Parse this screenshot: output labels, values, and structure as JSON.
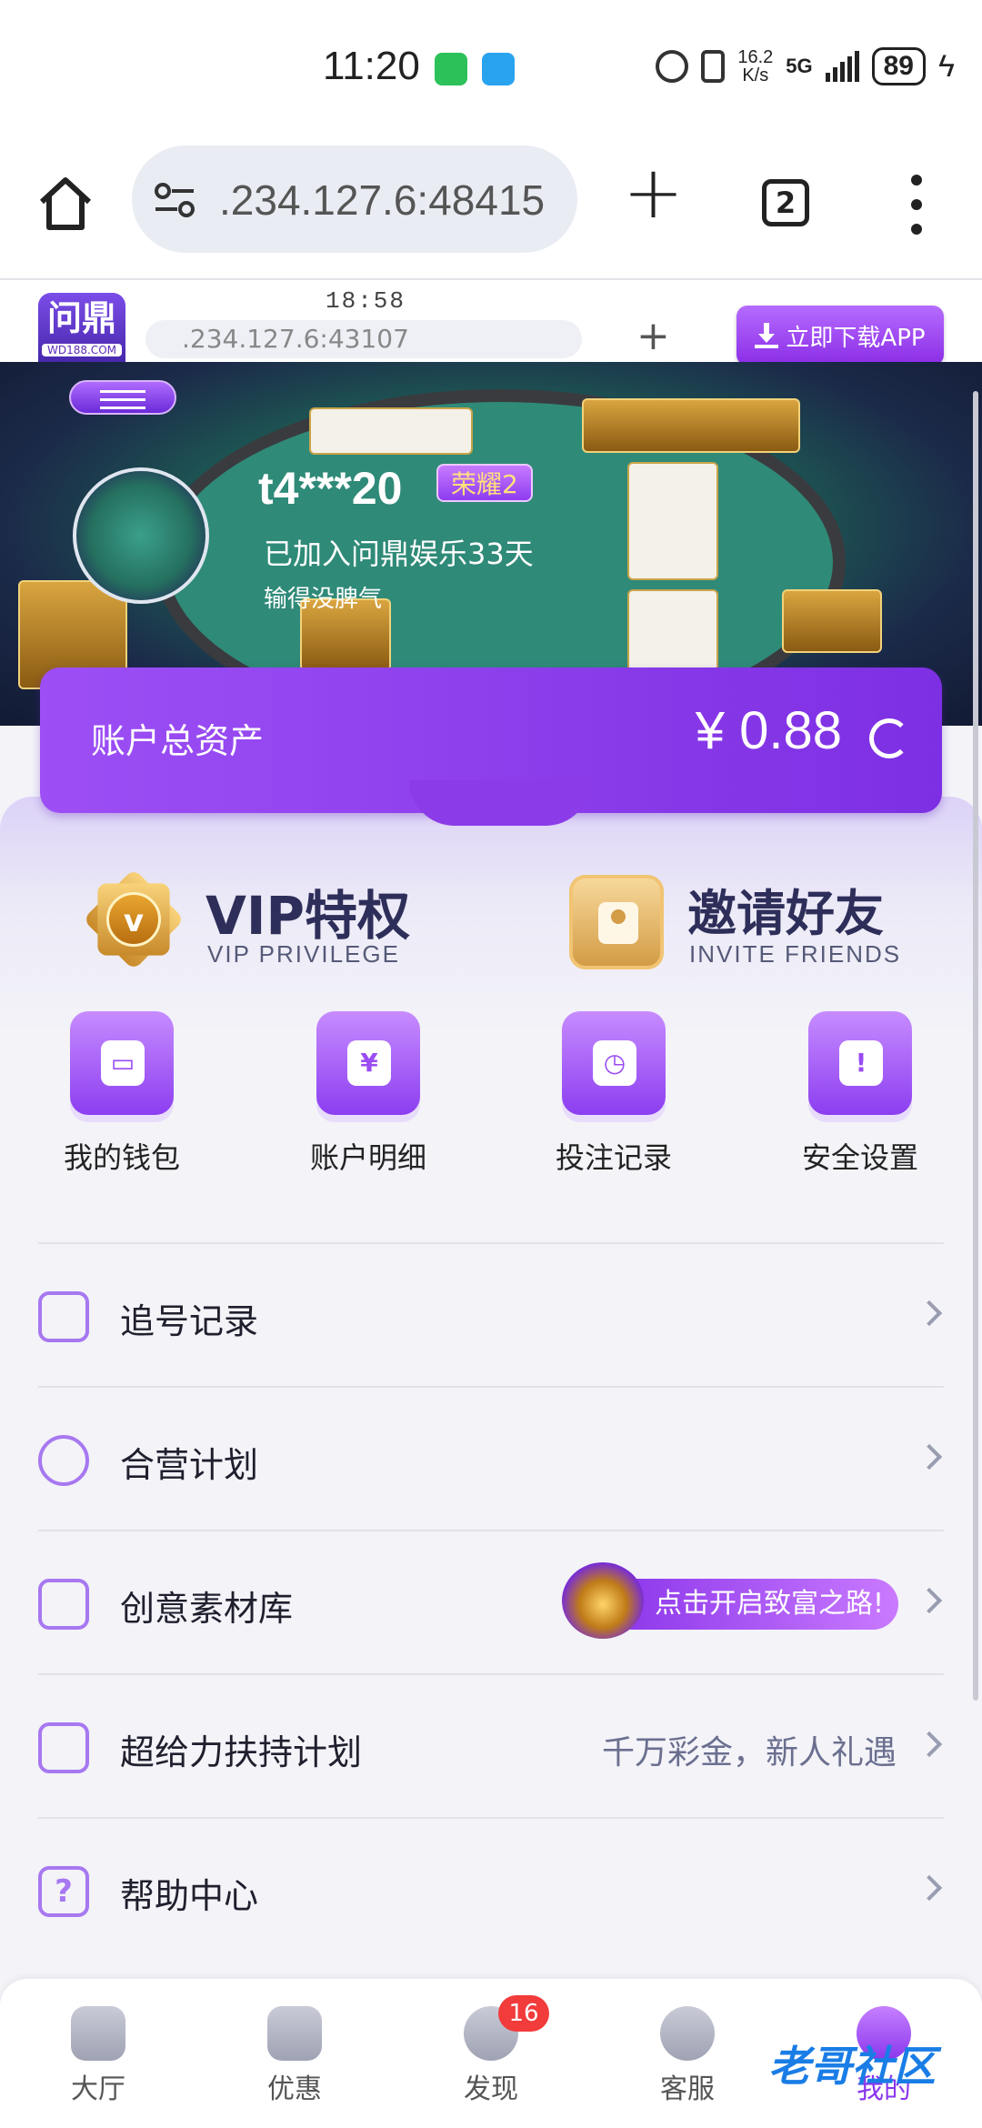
{
  "status_bar": {
    "time": "11:20",
    "net_speed": "16.2",
    "net_unit": "K/s",
    "network": "5G",
    "battery": "89"
  },
  "browser": {
    "url": ".234.127.6:48415",
    "tab_count": "2"
  },
  "inner_page": {
    "time": "18:58",
    "url": ".234.127.6:43107",
    "download_label": "立即下载APP",
    "logo_text": "问鼎",
    "logo_sub": "WD188.COM"
  },
  "profile": {
    "username": "t4***20",
    "rank": "荣耀2",
    "joined": "已加入问鼎娱乐33天",
    "motto": "输得没脾气"
  },
  "assets": {
    "label": "账户总资产",
    "amount": "¥ 0.88"
  },
  "features": {
    "vip": {
      "title": "VIP特权",
      "subtitle": "VIP PRIVILEGE",
      "badge": "v"
    },
    "invite": {
      "title": "邀请好友",
      "subtitle": "INVITE FRIENDS"
    }
  },
  "quick": [
    {
      "label": "我的钱包",
      "glyph": "▭"
    },
    {
      "label": "账户明细",
      "glyph": "¥"
    },
    {
      "label": "投注记录",
      "glyph": "◷"
    },
    {
      "label": "安全设置",
      "glyph": "!"
    }
  ],
  "rows": [
    {
      "label": "追号记录",
      "value": ""
    },
    {
      "label": "合营计划",
      "value": ""
    },
    {
      "label": "创意素材库",
      "value": "",
      "promo": "点击开启致富之路!"
    },
    {
      "label": "超给力扶持计划",
      "value": "千万彩金，新人礼遇"
    },
    {
      "label": "帮助中心",
      "value": ""
    }
  ],
  "nav": [
    {
      "label": "大厅"
    },
    {
      "label": "优惠"
    },
    {
      "label": "发现",
      "badge": "16"
    },
    {
      "label": "客服"
    },
    {
      "label": "我的"
    }
  ],
  "watermark": "老哥社区",
  "colors": {
    "accent": "#8a36ec",
    "assets_card": "#9d4ff5",
    "badge_red": "#f23b3b"
  }
}
